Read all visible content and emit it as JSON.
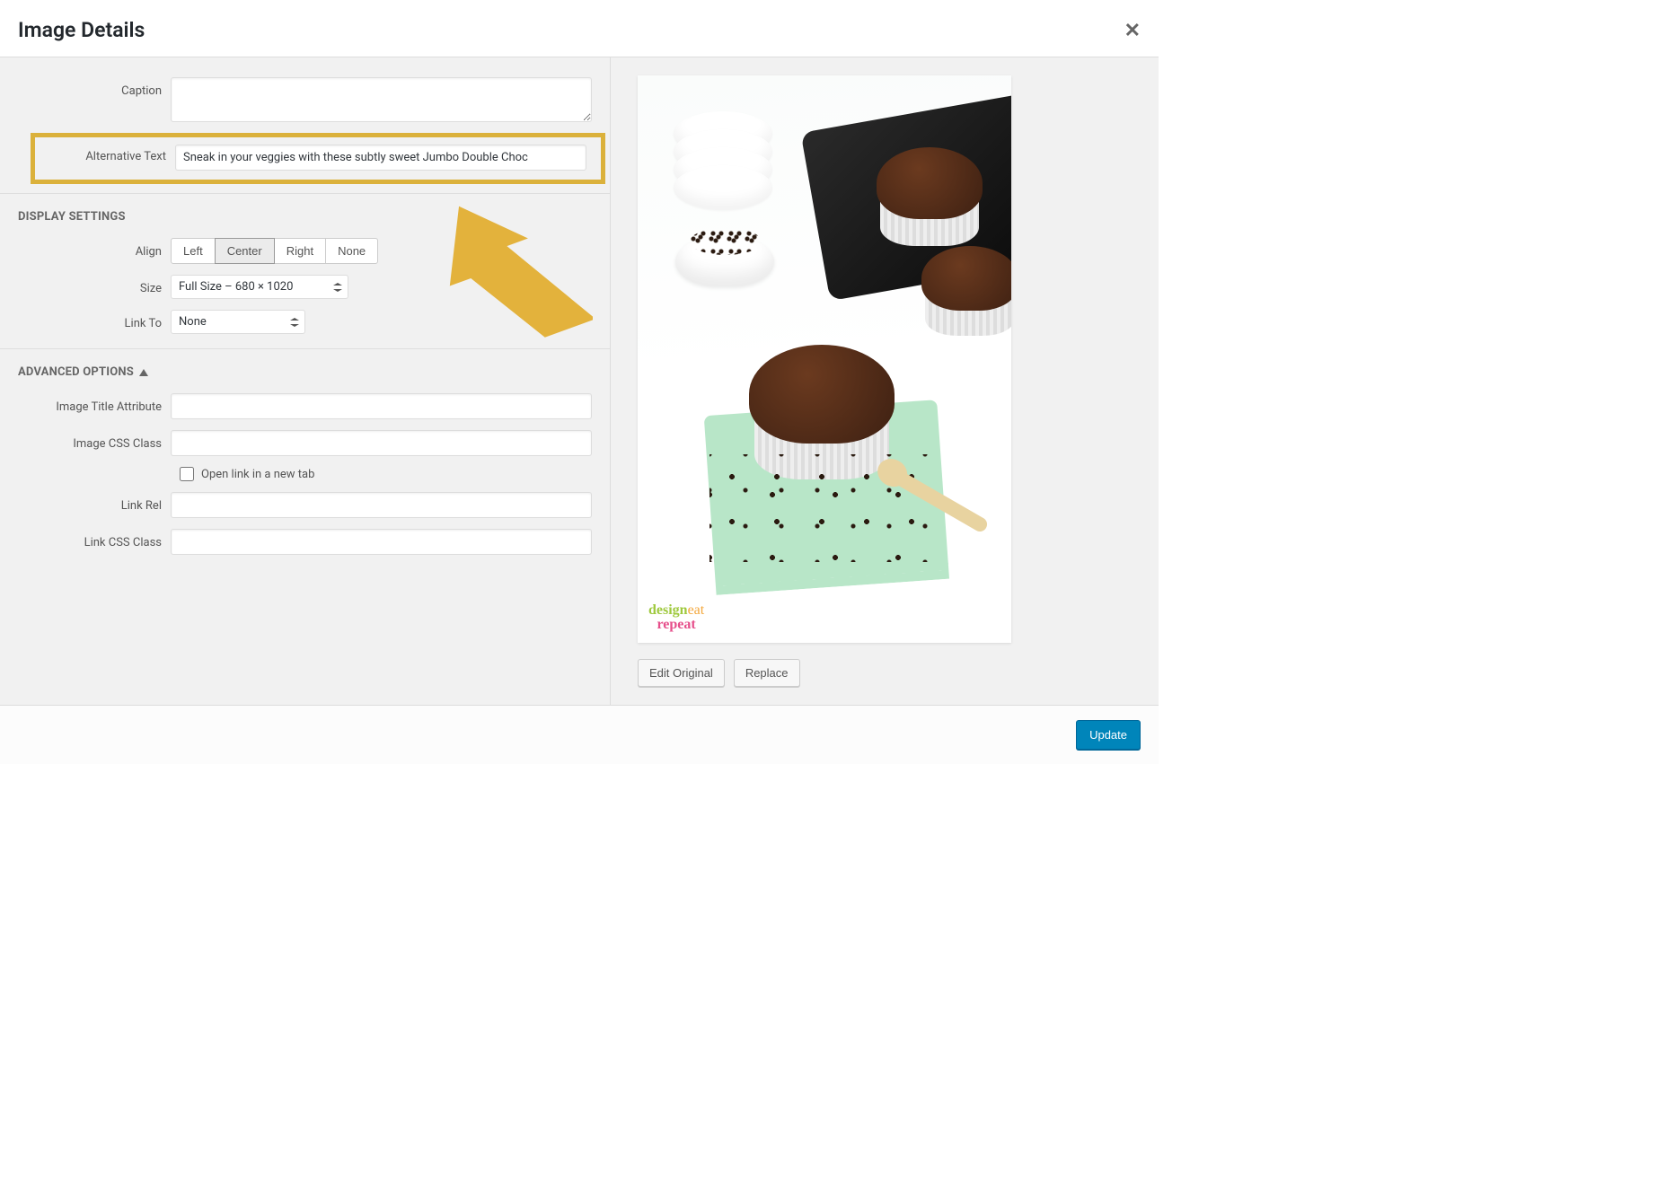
{
  "dialog": {
    "title": "Image Details",
    "close_label": "Close"
  },
  "fields": {
    "caption": {
      "label": "Caption",
      "value": ""
    },
    "alt_text": {
      "label": "Alternative Text",
      "value": "Sneak in your veggies with these subtly sweet Jumbo Double Choc"
    }
  },
  "display_settings": {
    "heading": "DISPLAY SETTINGS",
    "align": {
      "label": "Align",
      "options": {
        "left": "Left",
        "center": "Center",
        "right": "Right",
        "none": "None"
      },
      "selected": "center"
    },
    "size": {
      "label": "Size",
      "value": "Full Size – 680 × 1020"
    },
    "link_to": {
      "label": "Link To",
      "value": "None"
    }
  },
  "advanced": {
    "heading": "ADVANCED OPTIONS",
    "image_title_attr": {
      "label": "Image Title Attribute",
      "value": ""
    },
    "image_css_class": {
      "label": "Image CSS Class",
      "value": ""
    },
    "open_new_tab": {
      "label": "Open link in a new tab",
      "checked": false
    },
    "link_rel": {
      "label": "Link Rel",
      "value": ""
    },
    "link_css_class": {
      "label": "Link CSS Class",
      "value": ""
    }
  },
  "preview": {
    "edit_original": "Edit Original",
    "replace": "Replace",
    "logo": {
      "w1": "design",
      "w2": "eat",
      "w3": "repeat"
    }
  },
  "footer": {
    "update": "Update"
  },
  "annotation": {
    "highlight_color": "#dbb13b",
    "arrow_color": "#e3b23c"
  }
}
